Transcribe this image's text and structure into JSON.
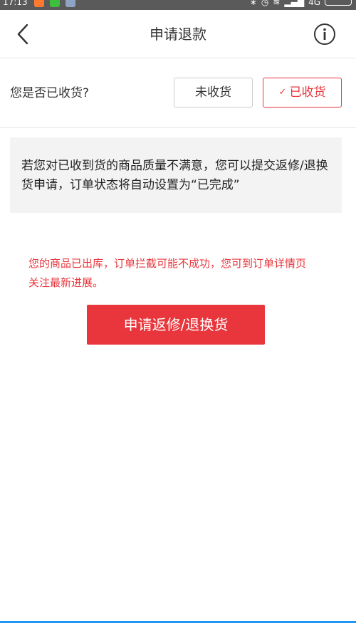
{
  "status_bar": {
    "time": "17:13",
    "network": "4G"
  },
  "nav": {
    "title": "申请退款"
  },
  "receipt": {
    "question": "您是否已收货?",
    "not_received_label": "未收货",
    "received_label": "已收货",
    "selected": "已收货"
  },
  "info": {
    "text": "若您对已收到货的商品质量不满意，您可以提交返修/退换货申请，订单状态将自动设置为“已完成”"
  },
  "warning": {
    "text": "您的商品已出库，订单拦截可能不成功，您可到订单详情页关注最新进展。"
  },
  "primary_button": {
    "label": "申请返修/退换货"
  },
  "colors": {
    "accent": "#e8363c",
    "divider": "#e6e6e6",
    "info_bg": "#f3f3f3"
  }
}
